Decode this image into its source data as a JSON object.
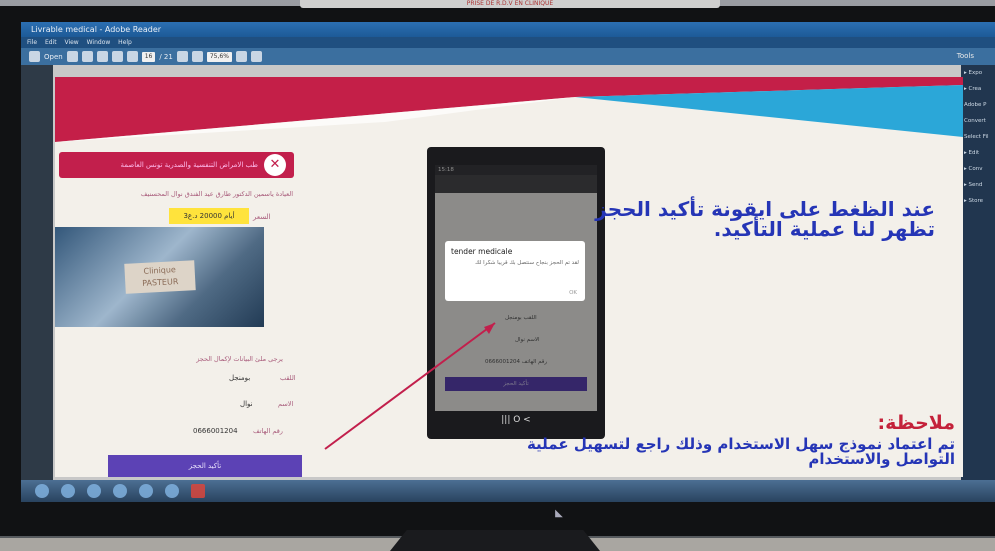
{
  "window": {
    "title": "Livrable medical - Adobe Reader",
    "menu": "File  Edit  View  Window  Help",
    "open_label": "Open",
    "page_field": "16",
    "page_total": "/ 21",
    "zoom": "75,6%",
    "tools_label": "Tools"
  },
  "top_strip": "PRISE DE R.D.V EN CLINIQUE",
  "right_pane": [
    "▸ Expo",
    "▸ Crea",
    "Adobe P",
    "Convert",
    "Select Fil",
    "▸ Edit",
    "▸ Conv",
    "▸ Send",
    "▸ Store"
  ],
  "slide": {
    "header": "طب الامراض التنفسية والصدرية   تونس العاصمة",
    "nav": "العيادة   ياسمين الدكتور طارق عيد   الفندق   نوال المحسنيف",
    "price_label": "السعر",
    "price_value": "3أيام  20000  د.ع",
    "photo_sign": "Clinique PASTEUR",
    "fill_prompt": "يرجى ملئ البيانات لإكمال الحجز",
    "field_title_label": "اللقب",
    "field_title_value": "بومنجل",
    "field_name_label": "الاسم",
    "field_name_value": "نوال",
    "field_phone_label": "رقم الهاتف",
    "field_phone_value": "0666001204",
    "confirm_button": "تأكيد الحجز",
    "phone": {
      "time": "15:18",
      "dialog_title": "tender medicale",
      "dialog_message": "لقد تم الحجز بنجاح سنتصل بك قريبا شكرا لك",
      "dialog_ok": "OK",
      "row1": "اللقب  بومنجل",
      "row2": "الاسم  نوال",
      "row3": "رقم الهاتف  0666001204",
      "button": "تأكيد الحجز",
      "nav_icons": "|||   O   <"
    },
    "main_text": "عند الظغط على ايقونة تأكيد الحجز تظهر لنا عملية التأكيد.",
    "note_title": "ملاحظة:",
    "note_text": "تم اعتماد نموذج سهل الاستخدام وذلك راجع لتسهيل عملية التواصل والاستخدام"
  },
  "colors": {
    "accent_red": "#c21f4c",
    "text_blue": "#2535b6",
    "button_purple": "#5c42b5",
    "price_yellow": "#ffe33c"
  }
}
